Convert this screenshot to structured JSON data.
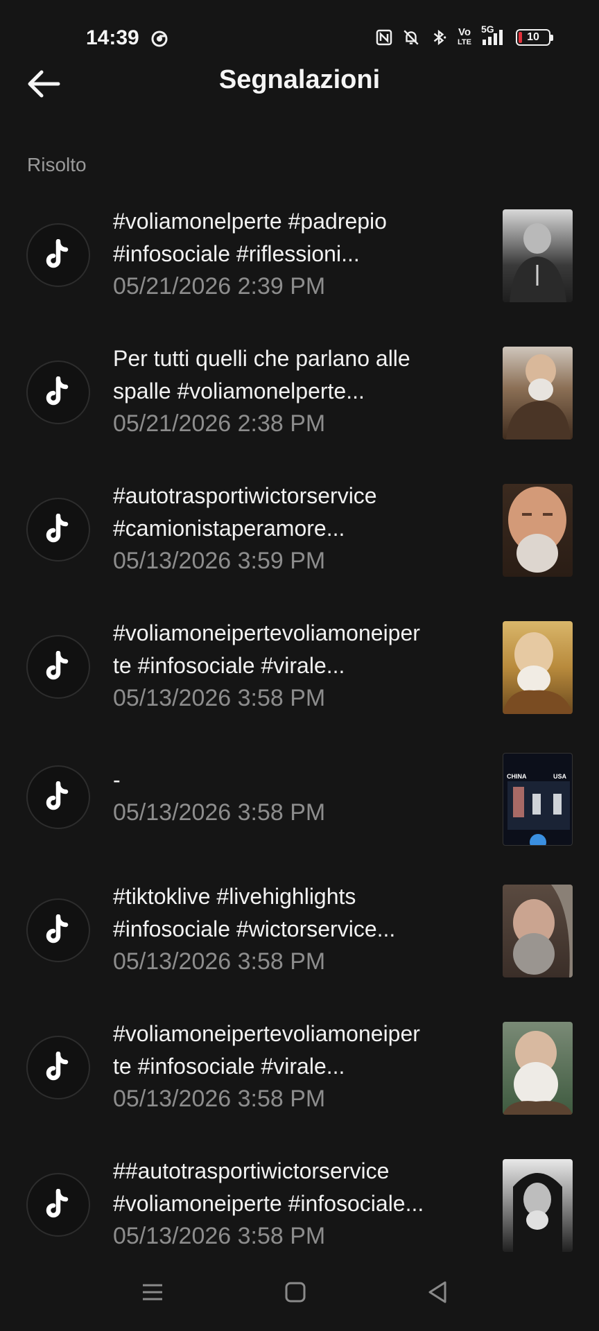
{
  "status_bar": {
    "time": "14:39",
    "network_label": "5G",
    "volte_top": "Vo",
    "volte_bottom": "LTE",
    "battery_level": "10",
    "battery_color": "#e0323b",
    "icons": [
      "chrome-icon",
      "nfc-icon",
      "mute-bell-icon",
      "bluetooth-icon",
      "volte-icon",
      "signal-icon",
      "battery-icon"
    ]
  },
  "header": {
    "title": "Segnalazioni",
    "back_icon": "arrow-left-icon"
  },
  "section": {
    "label": "Risolto"
  },
  "reports": [
    {
      "line1": "#voliamonelperte #padrepio",
      "line2": "#infosociale #riflessioni...",
      "date": "05/21/2026 2:39 PM",
      "thumb": "photo-dark-portrait"
    },
    {
      "line1": "Per tutti quelli che parlano alle",
      "line2": "spalle #voliamonelperte...",
      "date": "05/21/2026 2:38 PM",
      "thumb": "photo-brown-portrait"
    },
    {
      "line1": "#autotrasportiwictorservice",
      "line2": "#camionistaperamore...",
      "date": "05/13/2026 3:59 PM",
      "thumb": "photo-smiling-face"
    },
    {
      "line1": "#voliamoneipertevoliamoneiper",
      "line2": "te #infosociale #virale...",
      "date": "05/13/2026 3:58 PM",
      "thumb": "photo-sepia-portrait"
    },
    {
      "line1": "-",
      "line2": "",
      "date": "05/13/2026 3:58 PM",
      "thumb": "video-frame",
      "thumb_text_left": "CHINA",
      "thumb_text_right": "USA"
    },
    {
      "line1": "#tiktoklive #livehighlights",
      "line2": "#infosociale #wictorservice...",
      "date": "05/13/2026 3:58 PM",
      "thumb": "photo-gray-face"
    },
    {
      "line1": "#voliamoneipertevoliamoneiper",
      "line2": "te #infosociale #virale...",
      "date": "05/13/2026 3:58 PM",
      "thumb": "photo-green-portrait"
    },
    {
      "line1": "##autotrasportiwictorservice",
      "line2": "#voliamoneiperte #infosociale...",
      "date": "05/13/2026 3:58 PM",
      "thumb": "photo-bw-portrait"
    }
  ],
  "nav_bar": {
    "icons": [
      "menu-icon",
      "home-square-icon",
      "back-triangle-icon"
    ]
  }
}
